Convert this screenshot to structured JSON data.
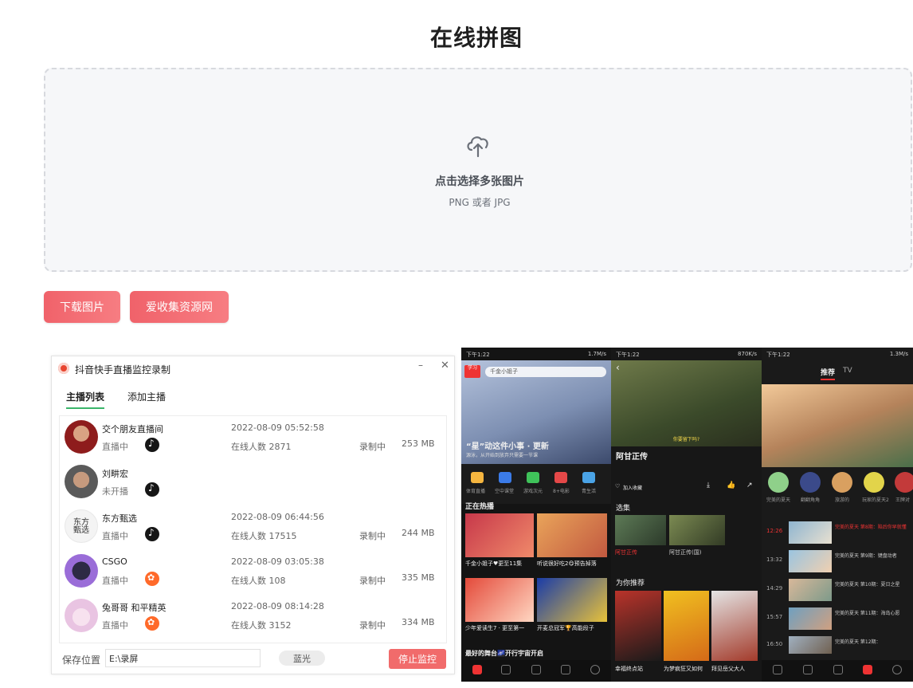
{
  "page": {
    "title": "在线拼图"
  },
  "dropzone": {
    "title": "点击选择多张图片",
    "subtitle": "PNG 或者 JPG"
  },
  "buttons": {
    "download": "下载图片",
    "resource_site": "爱收集资源网"
  },
  "app": {
    "title": "抖音快手直播监控录制",
    "tabs": [
      "主播列表",
      "添加主播"
    ],
    "streamers": [
      {
        "name": "交个朋友直播间",
        "status": "直播中",
        "platform": "douyin",
        "time": "2022-08-09 05:52:58",
        "viewers": "在线人数 2871",
        "rec": "录制中",
        "size": "253 MB"
      },
      {
        "name": "刘畊宏",
        "status": "未开播",
        "platform": "douyin",
        "time": "",
        "viewers": "",
        "rec": "",
        "size": ""
      },
      {
        "name": "东方甄选",
        "status": "直播中",
        "platform": "douyin",
        "time": "2022-08-09 06:44:56",
        "viewers": "在线人数 17515",
        "rec": "录制中",
        "size": "244 MB"
      },
      {
        "name": "CSGO",
        "status": "直播中",
        "platform": "kuaishou",
        "time": "2022-08-09 03:05:38",
        "viewers": "在线人数 108",
        "rec": "录制中",
        "size": "335 MB"
      },
      {
        "name": "兔哥哥 和平精英",
        "status": "直播中",
        "platform": "kuaishou",
        "time": "2022-08-09 08:14:28",
        "viewers": "在线人数 3152",
        "rec": "录制中",
        "size": "334 MB"
      }
    ],
    "save_label": "保存位置",
    "save_path": "E:\\录屏",
    "blue_button": "蓝光",
    "stop_button": "停止监控"
  },
  "phones": {
    "p1": {
      "time": "下午1:22",
      "net": "1.7M/s",
      "search": "千金小姐子",
      "banner": "“星”动这件小事 · 更新",
      "banner_sub": "源泳，从开始到放弃只需要一节课",
      "icons": [
        "体育直播",
        "空中课堂",
        "游戏次元",
        "8+电影",
        "青生活"
      ],
      "section": "正在热播",
      "cards": [
        "千金小姐子♥更至11集",
        "听说很好吃2😋预告掉落",
        "少年爱读生7 · 更至第一",
        "开麦总冠军🏆高能段子"
      ],
      "bottom": "最好的舞台🌌开行宇宙开启"
    },
    "p2": {
      "time": "下午1:22",
      "net": "870K/s",
      "subtitle": "你要留下吗?",
      "title": "阿甘正传",
      "actions": "加入收藏",
      "episodes_label": "选集",
      "eps": [
        "阿甘正传",
        "阿甘正传(国)"
      ],
      "recommend": "为你推荐",
      "movies": [
        "幸福终点站",
        "为梦疯狂又如何",
        "拜见岳父大人"
      ]
    },
    "p3": {
      "time": "下午1:22",
      "net": "1.3M/s",
      "tabs": [
        "推荐",
        "TV"
      ],
      "channels": [
        "完美的夏天",
        "翻翻角角",
        "旅游的",
        "玩家的夏天2",
        "王牌对"
      ],
      "schedule": [
        {
          "time": "12:26",
          "title": "完美的夏天 第8期：陷后你早就懂"
        },
        {
          "time": "13:32",
          "title": "完美的夏天 第9期：键盘动者"
        },
        {
          "time": "14:29",
          "title": "完美的夏天 第10期：夏日之星"
        },
        {
          "time": "15:57",
          "title": "完美的夏天 第11期：海岛心愿"
        },
        {
          "time": "16:50",
          "title": "完美的夏天 第12期："
        }
      ]
    }
  }
}
